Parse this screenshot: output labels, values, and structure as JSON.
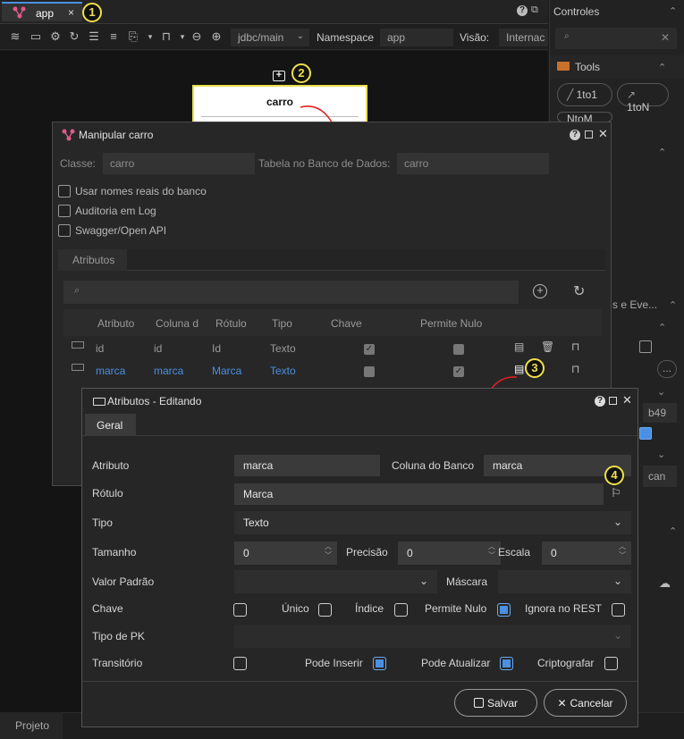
{
  "tabs": {
    "app_label": "app",
    "close": "×"
  },
  "badges": {
    "b1": "1",
    "b2": "2",
    "b3": "3",
    "b4": "4"
  },
  "toolbar": {
    "connection": "jdbc/main",
    "namespace_label": "Namespace",
    "namespace_value": "app",
    "visao_label": "Visão:",
    "visao_value": "Internac"
  },
  "entity": {
    "name": "carro"
  },
  "right_panel": {
    "title": "Controles",
    "tools_label": "Tools",
    "pill_1to1": "1to1",
    "pill_1toN": "1toN",
    "pill_ntom": "NtoM",
    "events_label": "s e Eve...",
    "field_b49": "b49",
    "field_can": "can",
    "dots": "..."
  },
  "bottom": {
    "projeto": "Projeto"
  },
  "dlg1": {
    "title": "Manipular carro",
    "classe_label": "Classe:",
    "classe_value": "carro",
    "tabela_label": "Tabela no Banco de Dados:",
    "tabela_value": "carro",
    "opt1": "Usar nomes reais do banco",
    "opt2": "Auditoria em Log",
    "opt3": "Swagger/Open API",
    "tab_atributos": "Atributos",
    "headers": [
      "Atributo",
      "Coluna d",
      "Rótulo",
      "Tipo",
      "Chave",
      "Permite Nulo"
    ],
    "rows": [
      {
        "atributo": "id",
        "coluna": "id",
        "rotulo": "Id",
        "tipo": "Texto",
        "chave": true,
        "nulo": false
      },
      {
        "atributo": "marca",
        "coluna": "marca",
        "rotulo": "Marca",
        "tipo": "Texto",
        "chave": false,
        "nulo": true
      }
    ]
  },
  "dlg2": {
    "title": "Atributos - Editando",
    "tab_geral": "Geral",
    "atributo_label": "Atributo",
    "atributo_value": "marca",
    "coluna_label": "Coluna do Banco",
    "coluna_value": "marca",
    "rotulo_label": "Rótulo",
    "rotulo_value": "Marca",
    "tipo_label": "Tipo",
    "tipo_value": "Texto",
    "tamanho_label": "Tamanho",
    "tamanho_value": "0",
    "precisao_label": "Precisão",
    "precisao_value": "0",
    "escala_label": "Escala",
    "escala_value": "0",
    "valor_padrao_label": "Valor Padrão",
    "valor_padrao_value": "",
    "mascara_label": "Máscara",
    "mascara_value": "",
    "chave_label": "Chave",
    "unico_label": "Único",
    "indice_label": "Índice",
    "permite_nulo_label": "Permite Nulo",
    "ignora_rest_label": "Ignora no REST",
    "tipo_pk_label": "Tipo de PK",
    "transitorio_label": "Transitório",
    "pode_inserir_label": "Pode Inserir",
    "pode_atualizar_label": "Pode Atualizar",
    "criptografar_label": "Criptografar",
    "checks": {
      "chave": false,
      "unico": false,
      "indice": false,
      "permite_nulo": true,
      "ignora_rest": false,
      "transitorio": false,
      "pode_inserir": true,
      "pode_atualizar": true,
      "criptografar": false
    },
    "salvar": "Salvar",
    "cancelar": "Cancelar"
  },
  "colors": {
    "accent": "#4a90e2",
    "highlight": "#f0e14a",
    "arrow": "#e02020",
    "app_icon": "#e05a8a"
  }
}
